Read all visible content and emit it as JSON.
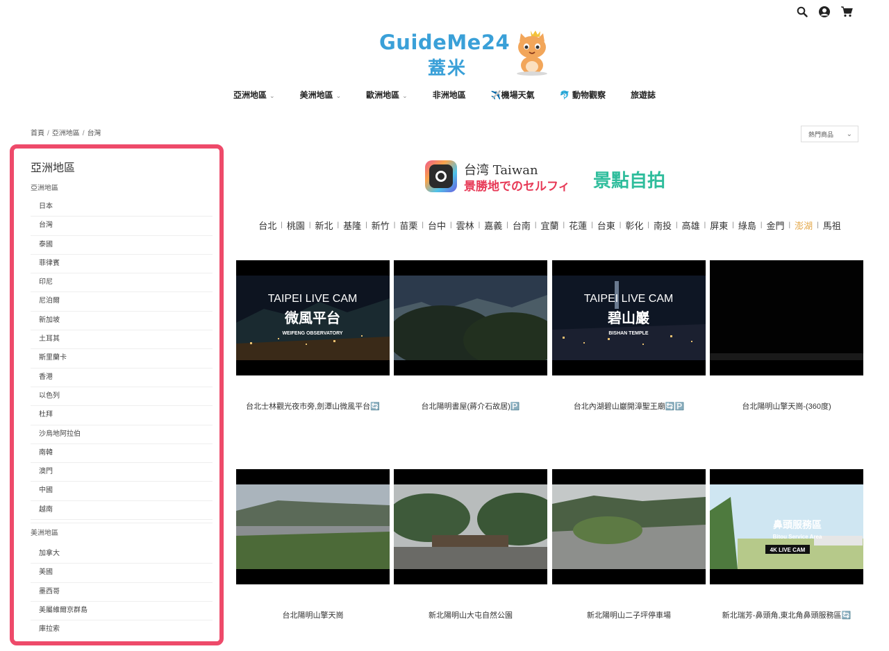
{
  "header": {
    "icons": [
      "search-icon",
      "user-icon",
      "cart-icon"
    ],
    "logo_text": "GuideMe24",
    "logo_sub": "蓋米"
  },
  "nav": {
    "items": [
      {
        "label": "亞洲地區",
        "has_dropdown": true
      },
      {
        "label": "美洲地區",
        "has_dropdown": true
      },
      {
        "label": "歐洲地區",
        "has_dropdown": true
      },
      {
        "label": "非洲地區",
        "has_dropdown": false
      },
      {
        "label": "✈️機場天氣",
        "has_dropdown": false
      },
      {
        "label": "🐬 動物觀察",
        "has_dropdown": false
      },
      {
        "label": "旅遊誌",
        "has_dropdown": false
      }
    ]
  },
  "breadcrumb": [
    "首頁",
    "亞洲地區",
    "台灣"
  ],
  "sort": {
    "selected": "熱門商品"
  },
  "sidebar": {
    "title": "亞洲地區",
    "groups": [
      {
        "label": "亞洲地區",
        "items": [
          "日本",
          "台灣",
          "泰國",
          "菲律賓",
          "印尼",
          "尼泊爾",
          "新加坡",
          "土耳其",
          "斯里蘭卡",
          "香港",
          "以色列",
          "杜拜",
          "沙烏地阿拉伯",
          "南韓",
          "澳門",
          "中國",
          "越南"
        ]
      },
      {
        "label": "美洲地區",
        "items": [
          "加拿大",
          "美國",
          "墨西哥",
          "美屬維爾京群島",
          "庫拉索"
        ]
      }
    ]
  },
  "banner": {
    "line1": "台湾 Taiwan",
    "line2": "景勝地でのセルフィ",
    "line3": "景點自拍"
  },
  "cities": {
    "items": [
      "台北",
      "桃園",
      "新北",
      "基隆",
      "新竹",
      "苗栗",
      "台中",
      "雲林",
      "嘉義",
      "台南",
      "宜蘭",
      "花蓮",
      "台東",
      "彰化",
      "南投",
      "高雄",
      "屏東",
      "綠島",
      "金門",
      "澎湖",
      "馬祖"
    ],
    "active": "澎湖"
  },
  "products": [
    {
      "title": "台北士林觀光夜市旁,劍潭山微風平台🔄",
      "overlay_en": "TAIPEI LIVE CAM",
      "overlay_zh": "微風平台",
      "overlay_sub": "WEIFENG OBSERVATORY"
    },
    {
      "title": "台北陽明書屋(蔣介石故居)🅿️"
    },
    {
      "title": "台北內湖碧山巖開漳聖王廟🔄🅿️",
      "overlay_en": "TAIPEI LIVE CAM",
      "overlay_zh": "碧山巖",
      "overlay_sub": "BISHAN TEMPLE"
    },
    {
      "title": "台北陽明山擎天崗-(360度)"
    },
    {
      "title": "台北陽明山擎天崗"
    },
    {
      "title": "新北陽明山大屯自然公園"
    },
    {
      "title": "新北陽明山二子坪停車場"
    },
    {
      "title": "新北瑞芳-鼻頭角,東北角鼻頭服務區🔄",
      "overlay_zh": "鼻頭服務區",
      "overlay_sub": "Bitou Service Area",
      "overlay_badge": "4K LIVE CAM"
    }
  ]
}
